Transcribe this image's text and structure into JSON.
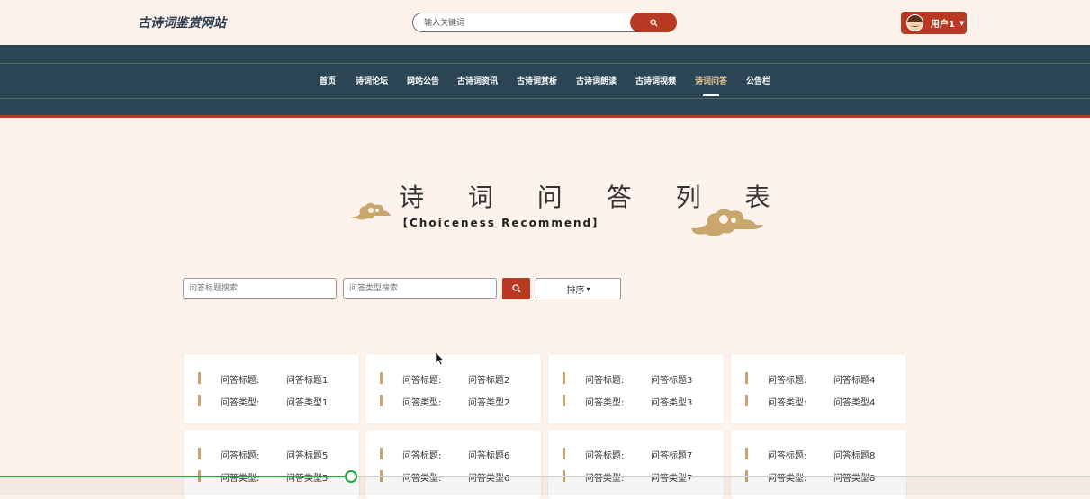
{
  "header": {
    "site_title": "古诗词鉴赏网站",
    "search_placeholder": "输入关键词",
    "user_label": "用户1",
    "accent_color": "#b83a22"
  },
  "nav": {
    "items": [
      "首页",
      "诗词论坛",
      "网站公告",
      "古诗词资讯",
      "古诗词赏析",
      "古诗词朗读",
      "古诗词视频",
      "诗词问答",
      "公告栏"
    ],
    "active": "诗词问答"
  },
  "section": {
    "title": "诗 词 问 答 列 表",
    "subtitle": "【Choiceness Recommend】"
  },
  "filters": {
    "title_placeholder": "问答标题搜索",
    "type_placeholder": "问答类型搜索",
    "sort_label": "排序",
    "sort_caret": "▾"
  },
  "cards": [
    {
      "title_label": "问答标题:",
      "title_value": "问答标题1",
      "type_label": "问答类型:",
      "type_value": "问答类型1"
    },
    {
      "title_label": "问答标题:",
      "title_value": "问答标题2",
      "type_label": "问答类型:",
      "type_value": "问答类型2"
    },
    {
      "title_label": "问答标题:",
      "title_value": "问答标题3",
      "type_label": "问答类型:",
      "type_value": "问答类型3"
    },
    {
      "title_label": "问答标题:",
      "title_value": "问答标题4",
      "type_label": "问答类型:",
      "type_value": "问答类型4"
    },
    {
      "title_label": "问答标题:",
      "title_value": "问答标题5",
      "type_label": "问答类型:",
      "type_value": "问答类型5"
    },
    {
      "title_label": "问答标题:",
      "title_value": "问答标题6",
      "type_label": "问答类型:",
      "type_value": "问答类型6"
    },
    {
      "title_label": "问答标题:",
      "title_value": "问答标题7",
      "type_label": "问答类型:",
      "type_value": "问答类型7"
    },
    {
      "title_label": "问答标题:",
      "title_value": "问答标题8",
      "type_label": "问答类型:",
      "type_value": "问答类型8"
    }
  ],
  "video_player": {
    "progress_fraction": 0.32
  }
}
